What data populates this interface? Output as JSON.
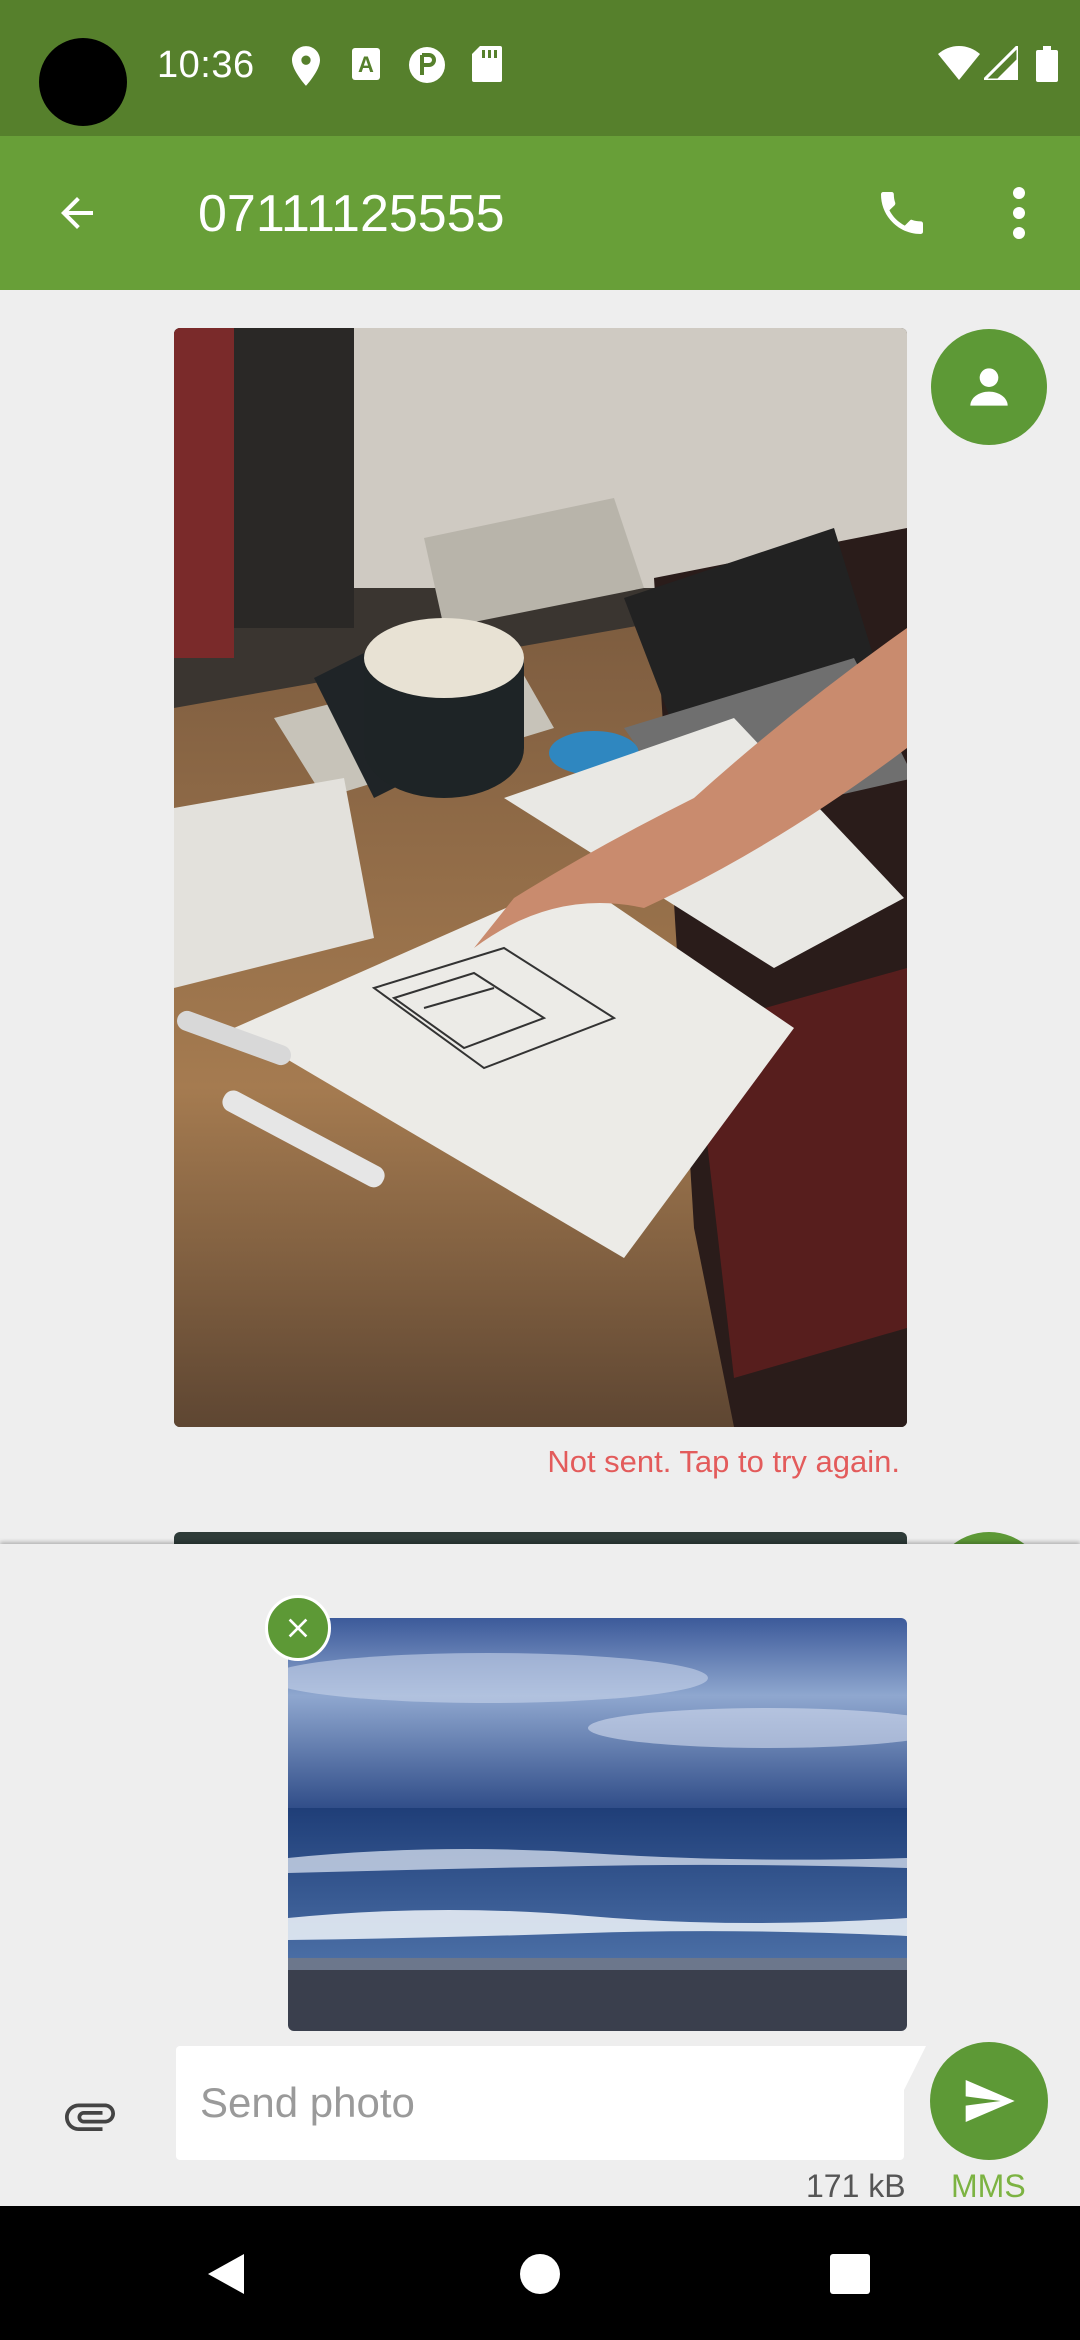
{
  "status_bar": {
    "time": "10:36",
    "icons": [
      "location-icon",
      "font-notification-icon",
      "clock-app-icon",
      "sd-card-icon",
      "wifi-icon",
      "signal-icon",
      "battery-icon"
    ]
  },
  "app_bar": {
    "title": "07111125555",
    "back_icon": "arrow-back-icon",
    "call_icon": "phone-icon",
    "menu_icon": "more-vert-icon"
  },
  "conversation": {
    "messages": [
      {
        "type": "image",
        "image_description": "desk-sketch-photo",
        "status": "Not sent. Tap to try again."
      }
    ]
  },
  "compose": {
    "attachment": "ocean-waves-photo",
    "placeholder": "Send photo",
    "size": "171 kB",
    "message_type": "MMS"
  },
  "colors": {
    "status_bar": "#56802c",
    "app_bar": "#689f38",
    "accent": "#5d9936",
    "error": "#e35b5b",
    "mms_label": "#7cb342"
  }
}
